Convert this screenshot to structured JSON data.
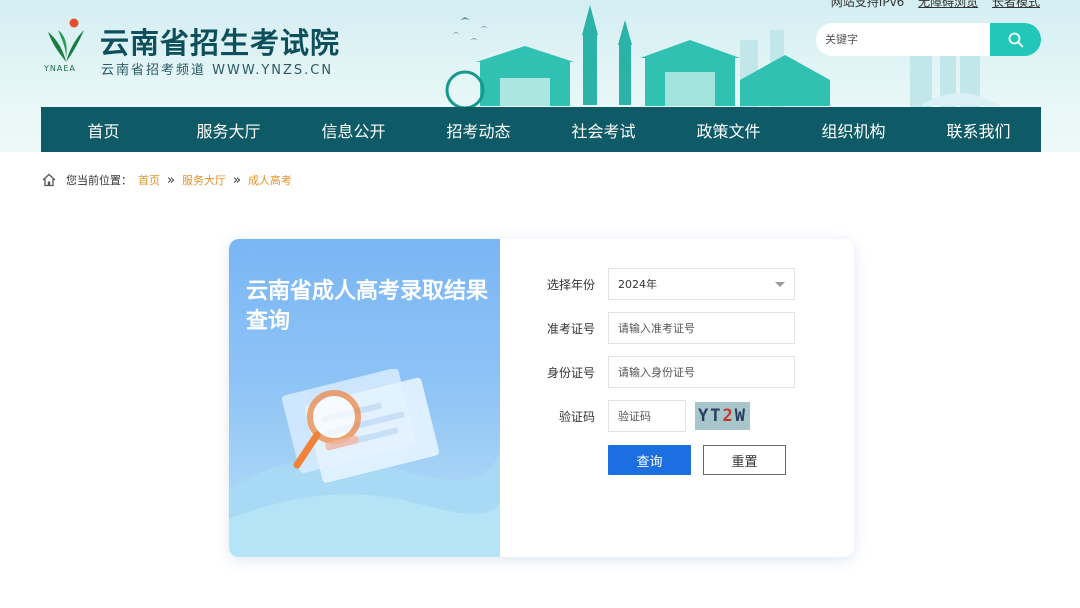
{
  "header": {
    "top_links": [
      "网站支持IPv6",
      "无障碍浏览",
      "长者模式"
    ],
    "title": "云南省招生考试院",
    "subtitle": "云南省招考频道 WWW.YNZS.CN",
    "logo_text": "YNAEA",
    "search": {
      "placeholder": "关键字",
      "icon": "search-icon"
    }
  },
  "nav": {
    "items": [
      "首页",
      "服务大厅",
      "信息公开",
      "招考动态",
      "社会考试",
      "政策文件",
      "组织机构",
      "联系我们"
    ]
  },
  "breadcrumb": {
    "prefix": "您当前位置：",
    "items": [
      "首页",
      "服务大厅",
      "成人高考"
    ],
    "separator": "»"
  },
  "card": {
    "title": "云南省成人高考录取结果查询",
    "form": {
      "year_label": "选择年份",
      "year_value": "2024年",
      "exam_no_label": "准考证号",
      "exam_no_placeholder": "请输入准考证号",
      "id_label": "身份证号",
      "id_placeholder": "请输入身份证号",
      "captcha_label": "验证码",
      "captcha_placeholder": "验证码",
      "captcha_chars": [
        "Y",
        "T",
        "2",
        "W"
      ],
      "query_button": "查询",
      "reset_button": "重置"
    }
  },
  "colors": {
    "nav_bg": "#0e5a66",
    "search_btn": "#21c7b8",
    "crumb_link": "#e8922b",
    "query_btn": "#1c6fe0"
  }
}
